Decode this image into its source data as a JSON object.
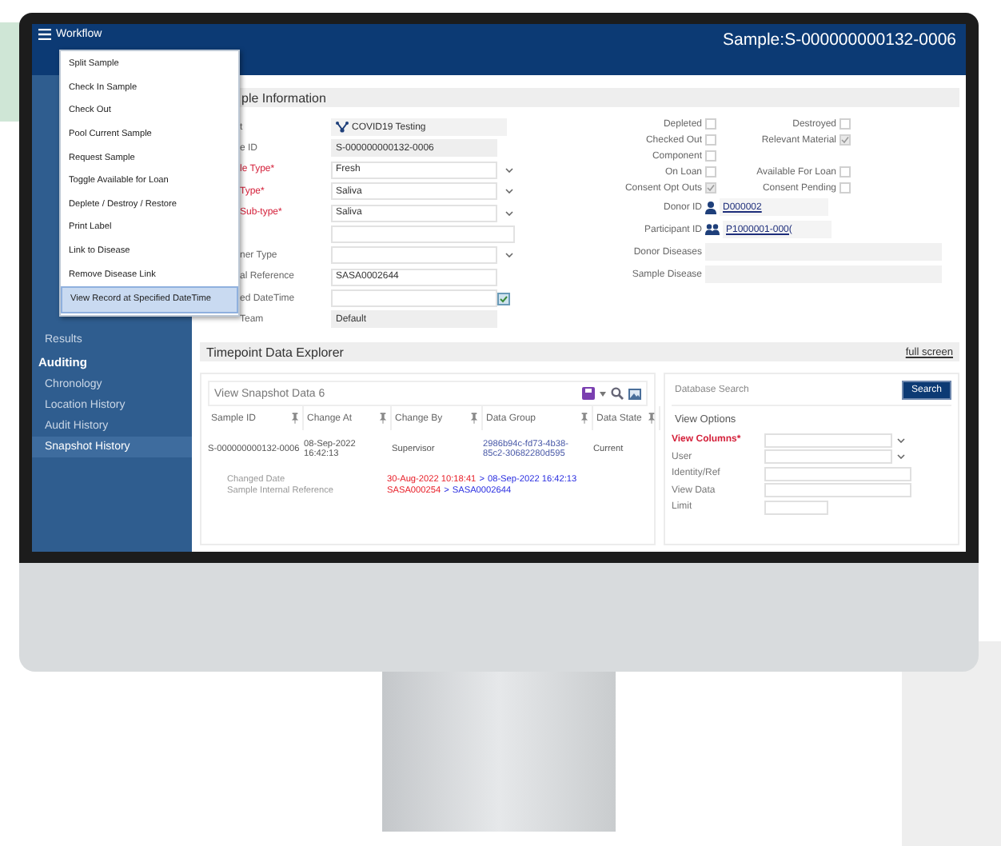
{
  "header": {
    "menu_label": "Workflow",
    "title": "Sample:S-000000000132-0006"
  },
  "workflow_menu": [
    {
      "label": "Split Sample",
      "selected": false
    },
    {
      "label": "Check In Sample",
      "selected": false
    },
    {
      "label": "Check Out",
      "selected": false
    },
    {
      "label": "Pool Current Sample",
      "selected": false
    },
    {
      "label": "Request Sample",
      "selected": false
    },
    {
      "label": "Toggle Available for Loan",
      "selected": false
    },
    {
      "label": "Deplete / Destroy / Restore",
      "selected": false
    },
    {
      "label": "Print Label",
      "selected": false
    },
    {
      "label": "Link to Disease",
      "selected": false
    },
    {
      "label": "Remove Disease Link",
      "selected": false
    },
    {
      "label": "View Record at Specified DateTime",
      "selected": true
    }
  ],
  "sidebar": {
    "items": [
      {
        "label": "Results",
        "kind": "item",
        "selected": false
      },
      {
        "label": "Auditing",
        "kind": "header",
        "selected": false
      },
      {
        "label": "Chronology",
        "kind": "item",
        "selected": false
      },
      {
        "label": "Location History",
        "kind": "item",
        "selected": false
      },
      {
        "label": "Audit History",
        "kind": "item",
        "selected": false
      },
      {
        "label": "Snapshot History",
        "kind": "item",
        "selected": true
      }
    ]
  },
  "sample_info": {
    "title": "ple Information",
    "fields": [
      {
        "label": "t",
        "value": "COVID19 Testing",
        "kind": "project",
        "required": false
      },
      {
        "label": "e ID",
        "value": "S-000000000132-0006",
        "kind": "readonly",
        "required": false
      },
      {
        "label": "le Type*",
        "value": "Fresh",
        "kind": "select",
        "required": true
      },
      {
        "label": "Type*",
        "value": "Saliva",
        "kind": "select",
        "required": true
      },
      {
        "label": "Sub-type*",
        "value": "Saliva",
        "kind": "select",
        "required": true
      },
      {
        "kind": "wide-select"
      },
      {
        "label": "ner Type",
        "kind": "select",
        "required": false
      },
      {
        "label": "al Reference",
        "value": "SASA0002644",
        "kind": "text",
        "required": false
      },
      {
        "label": "ed DateTime",
        "kind": "date",
        "required": false
      },
      {
        "label": "Team",
        "value": "Default",
        "kind": "readonly",
        "required": false
      }
    ],
    "flag_rows": [
      {
        "items": [
          {
            "label": "Depleted",
            "checked": false
          },
          {
            "label": "Destroyed",
            "checked": false
          }
        ]
      },
      {
        "items": [
          {
            "label": "Checked Out",
            "checked": false
          },
          {
            "label": "Relevant Material",
            "checked": true
          }
        ]
      },
      {
        "items": [
          {
            "label": "Component",
            "checked": false
          }
        ]
      },
      {
        "items": [
          {
            "label": "On Loan",
            "checked": false
          },
          {
            "label": "Available For Loan",
            "checked": false
          }
        ]
      },
      {
        "items": [
          {
            "label": "Consent Opt Outs",
            "checked": true
          },
          {
            "label": "Consent Pending",
            "checked": false
          }
        ]
      }
    ],
    "right_fields": [
      {
        "label": "Donor ID",
        "value": "D000002",
        "kind": "donor"
      },
      {
        "label": "Participant ID",
        "value": "P1000001-000(",
        "kind": "participant"
      },
      {
        "label": "Donor Diseases",
        "kind": "field"
      },
      {
        "label": "Sample Disease",
        "kind": "field"
      }
    ]
  },
  "explorer": {
    "title": "Timepoint Data Explorer",
    "full_screen": "full screen",
    "grid": {
      "title": "View Snapshot Data 6",
      "columns": [
        "Sample ID",
        "Change At",
        "Change By",
        "Data Group",
        "Data State"
      ],
      "rows": [
        {
          "cells": [
            "S-000000000132-0006",
            "08-Sep-2022 16:42:13",
            "Supervisor",
            "2986b94c-fd73-4b38-85c2-30682280d595",
            "Current"
          ]
        }
      ],
      "changes": [
        {
          "label": "Changed Date",
          "old": "30-Aug-2022 10:18:41",
          "separator": ">",
          "new": "08-Sep-2022 16:42:13"
        },
        {
          "label": "Sample Internal Reference",
          "old": "SASA000254",
          "separator": ">",
          "new": "SASA0002644"
        }
      ]
    },
    "search": {
      "placeholder": "Database Search",
      "button": "Search"
    },
    "view_options": {
      "title": "View Options",
      "fields": [
        {
          "label": "View Columns*",
          "required": true,
          "kind": "select"
        },
        {
          "label": "User",
          "required": false,
          "kind": "select"
        },
        {
          "label": "Identity/Ref",
          "required": false,
          "kind": "text"
        },
        {
          "label": "View Data",
          "required": false,
          "kind": "text"
        },
        {
          "label": "Limit",
          "required": false,
          "kind": "short"
        }
      ]
    }
  }
}
